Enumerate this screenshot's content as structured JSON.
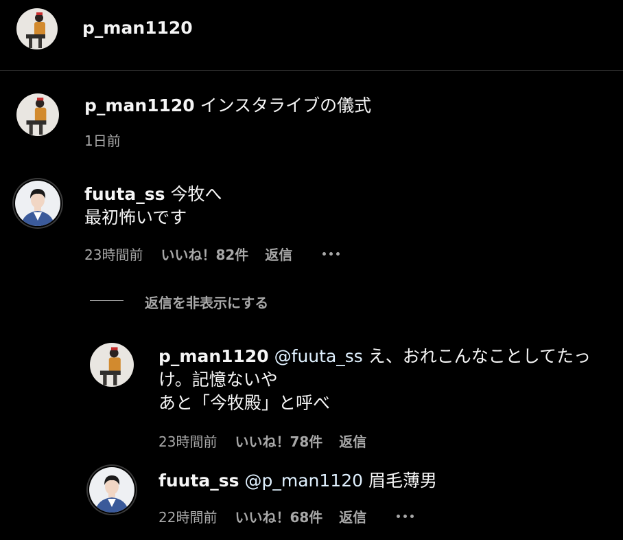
{
  "header": {
    "username": "p_man1120"
  },
  "caption": {
    "username": "p_man1120",
    "text": "インスタライブの儀式",
    "time": "1日前"
  },
  "comment": {
    "username": "fuuta_ss",
    "line1": "今牧へ",
    "line2": "最初怖いです",
    "time": "23時間前",
    "likes": "いいね！82件",
    "reply": "返信"
  },
  "hide_replies": "返信を非表示にする",
  "replies": [
    {
      "username": "p_man1120",
      "mention": "@fuuta_ss",
      "line1": "え、おれこんなことしてたっ",
      "line2": "け。記憶ないや",
      "line3": "あと「今牧殿」と呼べ",
      "time": "23時間前",
      "likes": "いいね！78件",
      "reply": "返信"
    },
    {
      "username": "fuuta_ss",
      "mention": "@p_man1120",
      "text": "眉毛薄男",
      "time": "22時間前",
      "likes": "いいね！68件",
      "reply": "返信"
    }
  ],
  "colors": {
    "background": "#000000",
    "text": "#f5f5f5",
    "secondary": "#a8a8a8",
    "divider": "#2b2b2b"
  }
}
